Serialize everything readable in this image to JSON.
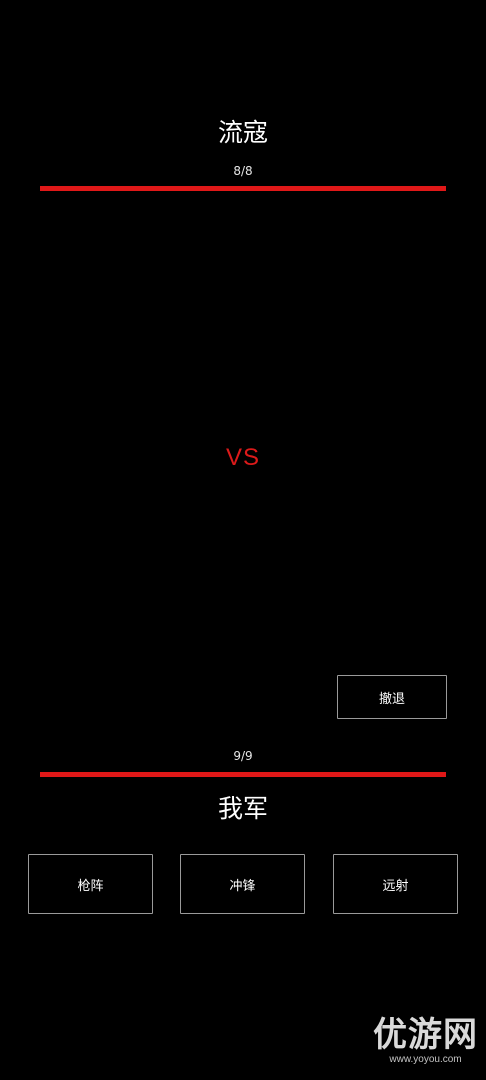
{
  "enemy": {
    "name": "流寇",
    "hp_text": "8/8",
    "hp_fraction": 1.0
  },
  "vs_label": "VS",
  "retreat_label": "撤退",
  "player": {
    "hp_text": "9/9",
    "hp_fraction": 1.0,
    "name": "我军"
  },
  "actions": {
    "spear_label": "枪阵",
    "charge_label": "冲锋",
    "ranged_label": "远射"
  },
  "watermark": {
    "main": "优游网",
    "url": "www.yoyou.com"
  },
  "colors": {
    "background": "#000000",
    "hp_bar": "#e01818",
    "vs": "#dc1a1a",
    "button_border": "#9a9a9a"
  }
}
